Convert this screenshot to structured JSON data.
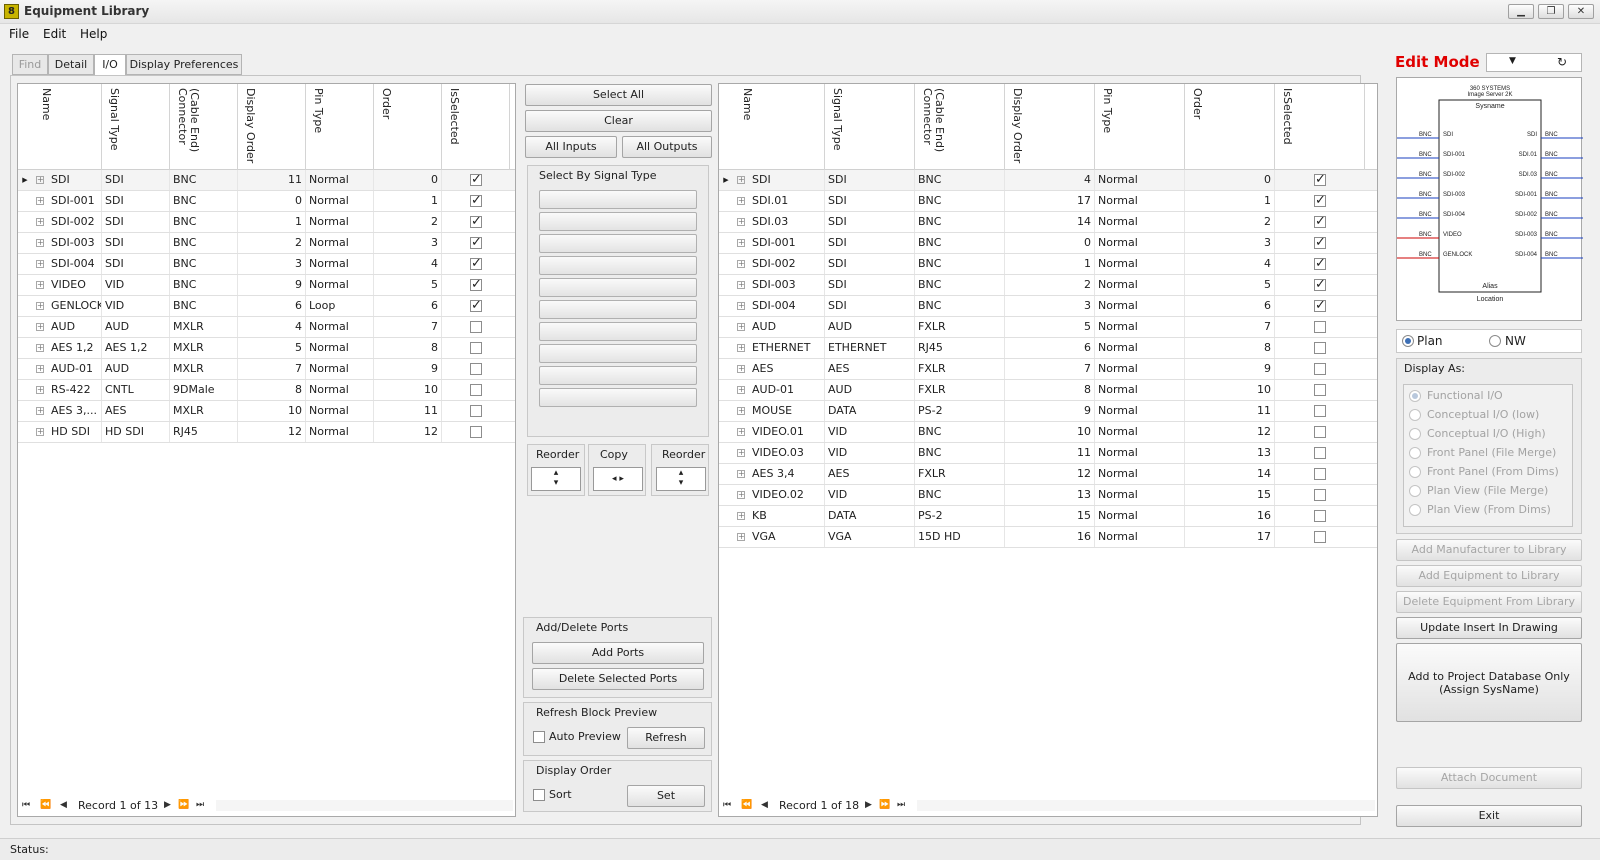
{
  "window": {
    "title": "Equipment Library",
    "app_icon": "8",
    "minimize": "▁",
    "restore": "❐",
    "close": "✕"
  },
  "menu": [
    "File",
    "Edit",
    "Help"
  ],
  "tabs": [
    "Find",
    "Detail",
    "I/O",
    "Display Preferences"
  ],
  "grid_columns": [
    "Name",
    "Signal Type",
    "(Cable End)\nConnector",
    "Display Order",
    "Pin Type",
    "Order",
    "IsSelected"
  ],
  "left_grid": {
    "rows": [
      {
        "name": "SDI",
        "signal": "SDI",
        "connector": "BNC",
        "display_order": "11",
        "pin_type": "Normal",
        "order": "0",
        "selected": true
      },
      {
        "name": "SDI-001",
        "signal": "SDI",
        "connector": "BNC",
        "display_order": "0",
        "pin_type": "Normal",
        "order": "1",
        "selected": true
      },
      {
        "name": "SDI-002",
        "signal": "SDI",
        "connector": "BNC",
        "display_order": "1",
        "pin_type": "Normal",
        "order": "2",
        "selected": true
      },
      {
        "name": "SDI-003",
        "signal": "SDI",
        "connector": "BNC",
        "display_order": "2",
        "pin_type": "Normal",
        "order": "3",
        "selected": true
      },
      {
        "name": "SDI-004",
        "signal": "SDI",
        "connector": "BNC",
        "display_order": "3",
        "pin_type": "Normal",
        "order": "4",
        "selected": true
      },
      {
        "name": "VIDEO",
        "signal": "VID",
        "connector": "BNC",
        "display_order": "9",
        "pin_type": "Normal",
        "order": "5",
        "selected": true
      },
      {
        "name": "GENLOCK",
        "signal": "VID",
        "connector": "BNC",
        "display_order": "6",
        "pin_type": "Loop",
        "order": "6",
        "selected": true
      },
      {
        "name": "AUD",
        "signal": "AUD",
        "connector": "MXLR",
        "display_order": "4",
        "pin_type": "Normal",
        "order": "7",
        "selected": false
      },
      {
        "name": "AES 1,2",
        "signal": "AES 1,2",
        "connector": "MXLR",
        "display_order": "5",
        "pin_type": "Normal",
        "order": "8",
        "selected": false
      },
      {
        "name": "AUD-01",
        "signal": "AUD",
        "connector": "MXLR",
        "display_order": "7",
        "pin_type": "Normal",
        "order": "9",
        "selected": false
      },
      {
        "name": "RS-422",
        "signal": "CNTL",
        "connector": "9DMale",
        "display_order": "8",
        "pin_type": "Normal",
        "order": "10",
        "selected": false
      },
      {
        "name": "AES 3,...",
        "signal": "AES",
        "connector": "MXLR",
        "display_order": "10",
        "pin_type": "Normal",
        "order": "11",
        "selected": false
      },
      {
        "name": "HD SDI",
        "signal": "HD SDI",
        "connector": "RJ45",
        "display_order": "12",
        "pin_type": "Normal",
        "order": "12",
        "selected": false
      }
    ],
    "record_text": "Record 1 of 13"
  },
  "right_grid": {
    "rows": [
      {
        "name": "SDI",
        "signal": "SDI",
        "connector": "BNC",
        "display_order": "4",
        "pin_type": "Normal",
        "order": "0",
        "selected": true
      },
      {
        "name": "SDI.01",
        "signal": "SDI",
        "connector": "BNC",
        "display_order": "17",
        "pin_type": "Normal",
        "order": "1",
        "selected": true
      },
      {
        "name": "SDI.03",
        "signal": "SDI",
        "connector": "BNC",
        "display_order": "14",
        "pin_type": "Normal",
        "order": "2",
        "selected": true
      },
      {
        "name": "SDI-001",
        "signal": "SDI",
        "connector": "BNC",
        "display_order": "0",
        "pin_type": "Normal",
        "order": "3",
        "selected": true
      },
      {
        "name": "SDI-002",
        "signal": "SDI",
        "connector": "BNC",
        "display_order": "1",
        "pin_type": "Normal",
        "order": "4",
        "selected": true
      },
      {
        "name": "SDI-003",
        "signal": "SDI",
        "connector": "BNC",
        "display_order": "2",
        "pin_type": "Normal",
        "order": "5",
        "selected": true
      },
      {
        "name": "SDI-004",
        "signal": "SDI",
        "connector": "BNC",
        "display_order": "3",
        "pin_type": "Normal",
        "order": "6",
        "selected": true
      },
      {
        "name": "AUD",
        "signal": "AUD",
        "connector": "FXLR",
        "display_order": "5",
        "pin_type": "Normal",
        "order": "7",
        "selected": false
      },
      {
        "name": "ETHERNET",
        "signal": "ETHERNET",
        "connector": "RJ45",
        "display_order": "6",
        "pin_type": "Normal",
        "order": "8",
        "selected": false
      },
      {
        "name": "AES",
        "signal": "AES",
        "connector": "FXLR",
        "display_order": "7",
        "pin_type": "Normal",
        "order": "9",
        "selected": false
      },
      {
        "name": "AUD-01",
        "signal": "AUD",
        "connector": "FXLR",
        "display_order": "8",
        "pin_type": "Normal",
        "order": "10",
        "selected": false
      },
      {
        "name": "MOUSE",
        "signal": "DATA",
        "connector": "PS-2",
        "display_order": "9",
        "pin_type": "Normal",
        "order": "11",
        "selected": false
      },
      {
        "name": "VIDEO.01",
        "signal": "VID",
        "connector": "BNC",
        "display_order": "10",
        "pin_type": "Normal",
        "order": "12",
        "selected": false
      },
      {
        "name": "VIDEO.03",
        "signal": "VID",
        "connector": "BNC",
        "display_order": "11",
        "pin_type": "Normal",
        "order": "13",
        "selected": false
      },
      {
        "name": "AES 3,4",
        "signal": "AES",
        "connector": "FXLR",
        "display_order": "12",
        "pin_type": "Normal",
        "order": "14",
        "selected": false
      },
      {
        "name": "VIDEO.02",
        "signal": "VID",
        "connector": "BNC",
        "display_order": "13",
        "pin_type": "Normal",
        "order": "15",
        "selected": false
      },
      {
        "name": "KB",
        "signal": "DATA",
        "connector": "PS-2",
        "display_order": "15",
        "pin_type": "Normal",
        "order": "16",
        "selected": false
      },
      {
        "name": "VGA",
        "signal": "VGA",
        "connector": "15D HD",
        "display_order": "16",
        "pin_type": "Normal",
        "order": "17",
        "selected": false
      }
    ],
    "record_text": "Record 1 of 18"
  },
  "middle": {
    "select_all": "Select All",
    "clear": "Clear",
    "all_inputs": "All Inputs",
    "all_outputs": "All Outputs",
    "select_by_signal_type": "Select By Signal Type",
    "reorder": "Reorder",
    "copy": "Copy",
    "add_delete_ports": "Add/Delete Ports",
    "add_ports": "Add Ports",
    "delete_selected_ports": "Delete Selected Ports",
    "refresh_block_preview": "Refresh Block Preview",
    "auto_preview": "Auto Preview",
    "refresh": "Refresh",
    "display_order": "Display Order",
    "sort": "Sort",
    "set": "Set"
  },
  "right_panel": {
    "edit_mode": "Edit Mode",
    "preview": {
      "header1": "360 SYSTEMS",
      "header2": "Image Server 2K",
      "sysname": "Sysname",
      "alias": "Alias",
      "location": "Location",
      "left_ports": [
        "SDI",
        "SDI-001",
        "SDI-002",
        "SDI-003",
        "SDI-004",
        "VIDEO",
        "GENLOCK"
      ],
      "right_ports": [
        "SDI",
        "SDI.01",
        "SDI.03",
        "SDI-001",
        "SDI-002",
        "SDI-003",
        "SDI-004"
      ],
      "connector": "BNC"
    },
    "plan": "Plan",
    "nw": "NW",
    "display_as": "Display As:",
    "display_options": [
      "Functional I/O",
      "Conceptual I/O (low)",
      "Conceptual I/O (High)",
      "Front Panel (File Merge)",
      "Front Panel (From Dims)",
      "Plan View (File Merge)",
      "Plan View (From Dims)"
    ],
    "add_manufacturer": "Add Manufacturer to Library",
    "add_equipment": "Add Equipment to Library",
    "delete_equipment": "Delete Equipment From Library",
    "update_insert": "Update Insert In Drawing",
    "add_project_line1": "Add to Project Database Only",
    "add_project_line2": "(Assign SysName)",
    "attach_document": "Attach Document",
    "exit": "Exit"
  },
  "status": {
    "label": "Status:"
  },
  "colors": {
    "edit_mode": "#e00000",
    "input_line": "#1a3fbf",
    "output_line": "#cc0000"
  }
}
